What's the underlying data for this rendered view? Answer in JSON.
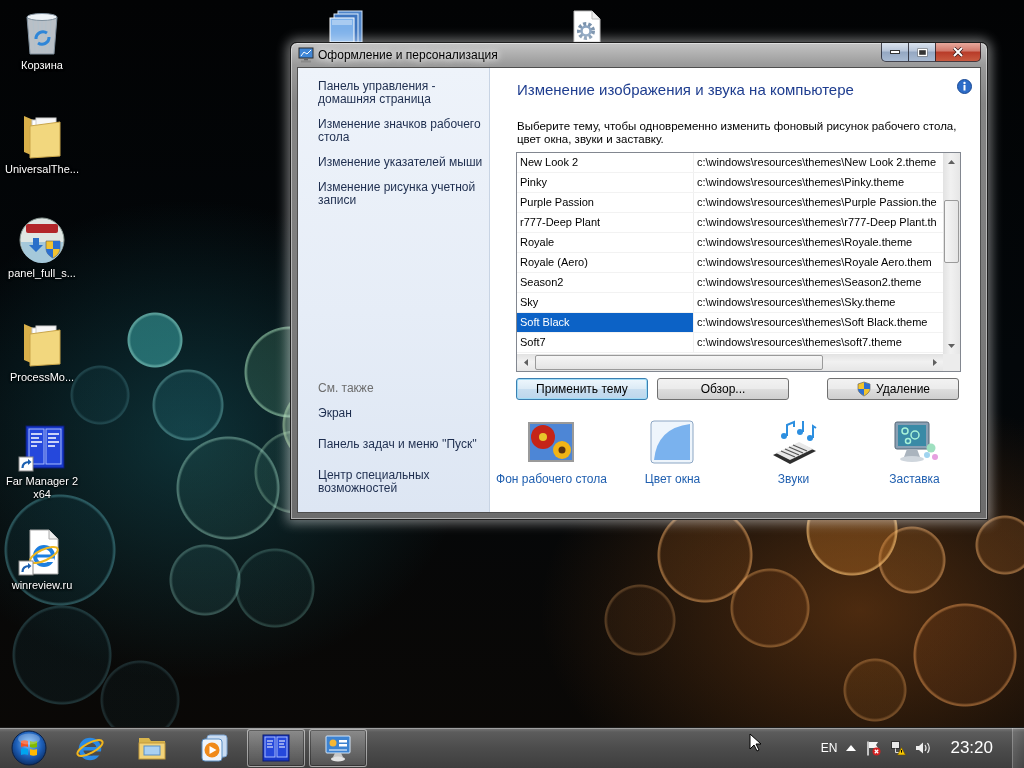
{
  "desktop": {
    "icons": [
      {
        "kind": "recycle-bin",
        "label": "Корзина"
      },
      {
        "kind": "folder",
        "label": "UniversalThe..."
      },
      {
        "kind": "installer",
        "label": "panel_full_s..."
      },
      {
        "kind": "folder",
        "label": "ProcessMo..."
      },
      {
        "kind": "far-shortcut",
        "label": "Far Manager 2 x64"
      },
      {
        "kind": "web-shortcut",
        "label": "winreview.ru"
      }
    ],
    "top_icons": [
      {
        "kind": "window-stack"
      },
      {
        "kind": "settings-file"
      }
    ]
  },
  "window": {
    "title": "Оформление и персонализация",
    "sidebar": {
      "links": [
        "Панель управления - домашняя страница",
        "Изменение значков рабочего стола",
        "Изменение указателей мыши",
        "Изменение рисунка учетной записи"
      ],
      "see_also_title": "См. также",
      "see_also": [
        "Экран",
        "Панель задач и меню ''Пуск''",
        "Центр специальных возможностей"
      ]
    },
    "heading": "Изменение изображения и звука на компьютере",
    "description": "Выберите тему, чтобы одновременно изменить фоновый рисунок рабочего стола, цвет окна, звуки и заставку.",
    "themes": [
      {
        "name": "New Look 2",
        "path": "c:\\windows\\resources\\themes\\New Look 2.theme",
        "selected": false
      },
      {
        "name": "Pinky",
        "path": "c:\\windows\\resources\\themes\\Pinky.theme",
        "selected": false
      },
      {
        "name": "Purple Passion",
        "path": "c:\\windows\\resources\\themes\\Purple Passion.the",
        "selected": false
      },
      {
        "name": "r777-Deep Plant",
        "path": "c:\\windows\\resources\\themes\\r777-Deep Plant.th",
        "selected": false
      },
      {
        "name": "Royale",
        "path": "c:\\windows\\resources\\themes\\Royale.theme",
        "selected": false
      },
      {
        "name": "Royale (Aero)",
        "path": "c:\\windows\\resources\\themes\\Royale Aero.them",
        "selected": false
      },
      {
        "name": "Season2",
        "path": "c:\\windows\\resources\\themes\\Season2.theme",
        "selected": false
      },
      {
        "name": "Sky",
        "path": "c:\\windows\\resources\\themes\\Sky.theme",
        "selected": false
      },
      {
        "name": "Soft Black",
        "path": "c:\\windows\\resources\\themes\\Soft Black.theme",
        "selected": true
      },
      {
        "name": "Soft7",
        "path": "c:\\windows\\resources\\themes\\soft7.theme",
        "selected": false
      }
    ],
    "buttons": [
      {
        "kind": "plain",
        "label": "Применить тему",
        "focused": true
      },
      {
        "kind": "plain",
        "label": "Обзор...",
        "focused": false
      },
      {
        "kind": "shielded",
        "label": "Удаление",
        "focused": false
      }
    ],
    "settings": [
      {
        "kind": "wallpaper",
        "label": "Фон рабочего стола"
      },
      {
        "kind": "window-color",
        "label": "Цвет окна"
      },
      {
        "kind": "sounds",
        "label": "Звуки"
      },
      {
        "kind": "screensaver",
        "label": "Заставка"
      }
    ]
  },
  "taskbar": {
    "items": [
      {
        "kind": "browser",
        "active": false
      },
      {
        "kind": "file-explorer",
        "active": false
      },
      {
        "kind": "media-player",
        "active": false
      },
      {
        "kind": "far-manager",
        "active": true
      },
      {
        "kind": "control-panel",
        "active": true
      }
    ],
    "language": "EN",
    "clock": "23:20"
  }
}
